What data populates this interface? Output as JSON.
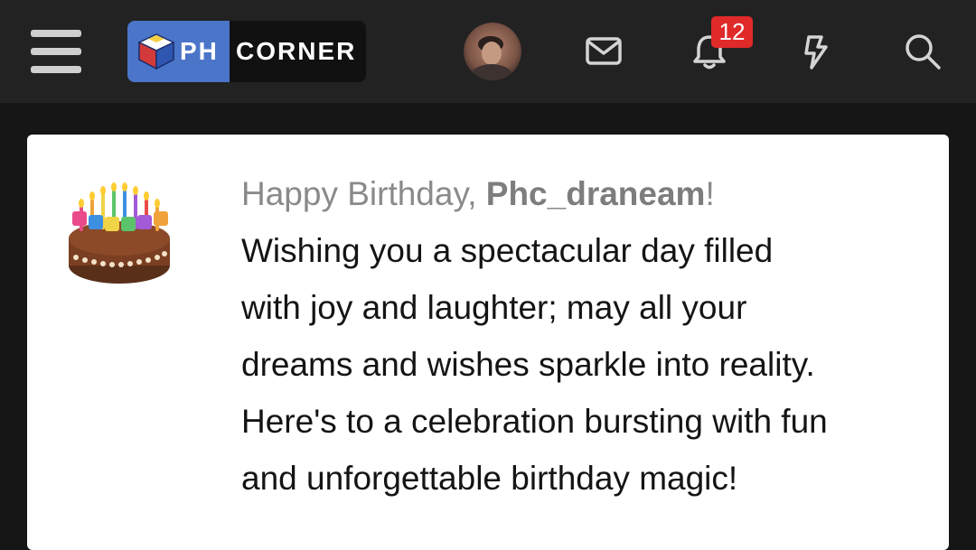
{
  "header": {
    "logo_ph": "PH",
    "logo_corner": "CORNER",
    "notification_count": "12"
  },
  "icons": {
    "menu": "hamburger-menu-icon",
    "messages": "envelope-icon",
    "alerts": "bell-icon",
    "whats_new": "lightning-bolt-icon",
    "search": "search-icon"
  },
  "colors": {
    "header_bg": "#222222",
    "page_bg": "#161616",
    "logo_blue": "#4a75c8",
    "badge_red": "#e02a2a",
    "card_bg": "#ffffff"
  },
  "birthday": {
    "greeting_prefix": "Happy Birthday, ",
    "username": "Phc_draneam",
    "greeting_suffix": "!",
    "lines": [
      "Wishing you a spectacular day filled",
      "with joy and laughter; may all your",
      "dreams and wishes sparkle into reality.",
      "Here's to a celebration bursting with fun",
      "and unforgettable birthday magic!"
    ]
  }
}
